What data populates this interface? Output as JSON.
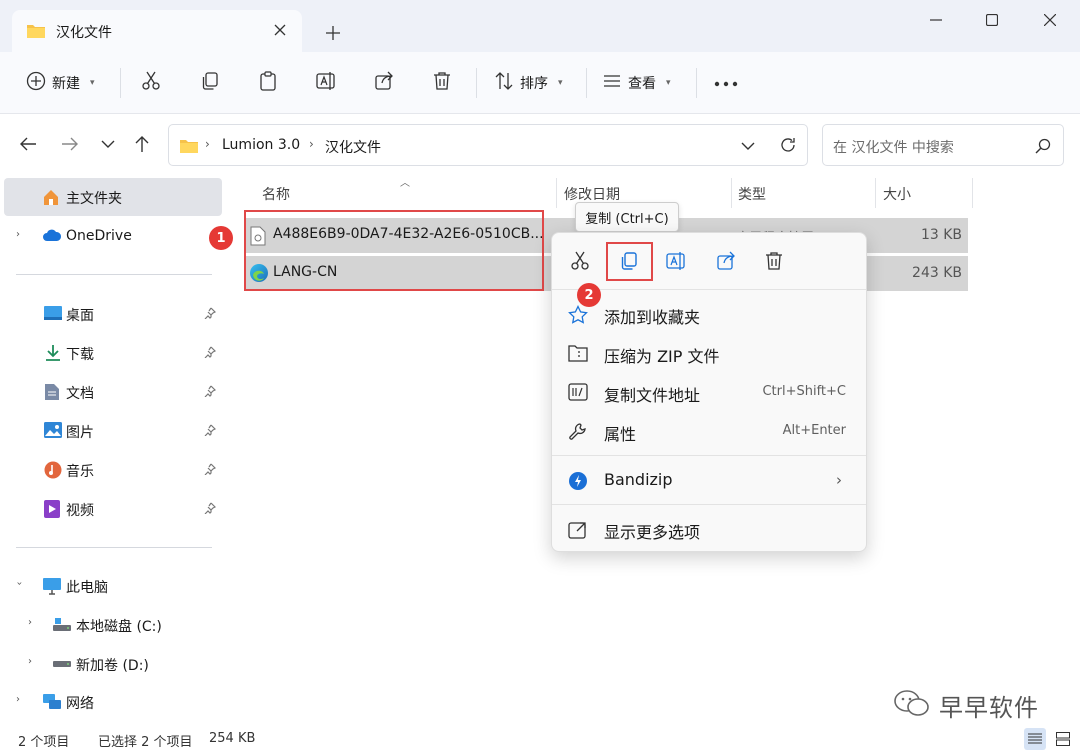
{
  "window": {
    "tab_title": "汉化文件"
  },
  "toolbar": {
    "new_label": "新建",
    "sort_label": "排序",
    "view_label": "查看"
  },
  "address": {
    "crumbs": [
      "Lumion 3.0",
      "汉化文件"
    ],
    "search_placeholder": "在 汉化文件 中搜索"
  },
  "sidebar": {
    "home": "主文件夹",
    "onedrive": "OneDrive",
    "quick": [
      "桌面",
      "下载",
      "文档",
      "图片",
      "音乐",
      "视频"
    ],
    "this_pc": "此电脑",
    "drives": [
      "本地磁盘 (C:)",
      "新加卷 (D:)"
    ],
    "network": "网络"
  },
  "columns": {
    "name": "名称",
    "modified": "修改日期",
    "type": "类型",
    "size": "大小"
  },
  "files": [
    {
      "name": "A488E6B9-0DA7-4E32-A2E6-0510CB...",
      "type": "应用程序扩展",
      "size": "13 KB"
    },
    {
      "name": "LANG-CN",
      "type": "",
      "size": "243 KB"
    }
  ],
  "badges": [
    "1",
    "2"
  ],
  "tooltip": "复制 (Ctrl+C)",
  "context_menu": {
    "items": [
      {
        "label": "添加到收藏夹",
        "shortcut": ""
      },
      {
        "label": "压缩为 ZIP 文件",
        "shortcut": ""
      },
      {
        "label": "复制文件地址",
        "shortcut": "Ctrl+Shift+C"
      },
      {
        "label": "属性",
        "shortcut": "Alt+Enter"
      },
      {
        "label": "Bandizip",
        "shortcut": ""
      },
      {
        "label": "显示更多选项",
        "shortcut": ""
      }
    ]
  },
  "status": {
    "count": "2 个项目",
    "selected": "已选择 2 个项目",
    "size": "254 KB"
  },
  "watermark": "早早软件"
}
